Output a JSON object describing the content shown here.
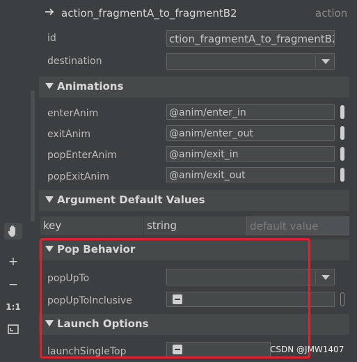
{
  "header": {
    "arrow_icon": "arrow-right-icon",
    "title": "action_fragmentA_to_fragmentB2",
    "kind": "action"
  },
  "properties": {
    "id_label": "id",
    "id_value": "ction_fragmentA_to_fragmentB2",
    "destination_label": "destination",
    "destination_value": ""
  },
  "animations": {
    "title": "Animations",
    "rows": [
      {
        "label": "enterAnim",
        "value": "@anim/enter_in"
      },
      {
        "label": "exitAnim",
        "value": "@anim/enter_out"
      },
      {
        "label": "popEnterAnim",
        "value": "@anim/exit_in"
      },
      {
        "label": "popExitAnim",
        "value": "@anim/exit_out"
      }
    ]
  },
  "argument_defaults": {
    "title": "Argument Default Values",
    "key": "key",
    "type": "string",
    "placeholder": "default value"
  },
  "pop_behavior": {
    "title": "Pop Behavior",
    "pop_up_to_label": "popUpTo",
    "pop_up_to_value": "",
    "inclusive_label": "popUpToInclusive"
  },
  "launch_options": {
    "title": "Launch Options",
    "single_top_label": "launchSingleTop"
  },
  "toolbar": {
    "pan_icon": "hand-icon",
    "zoom_in": "+",
    "zoom_out": "−",
    "actual_size": "1:1",
    "fit_icon": "fit-screen-icon"
  },
  "watermark": "CSDN @JMW1407",
  "colors": {
    "highlight": "#e0232a",
    "panel_bg": "#3c3f41",
    "section_bg": "#45494a"
  }
}
